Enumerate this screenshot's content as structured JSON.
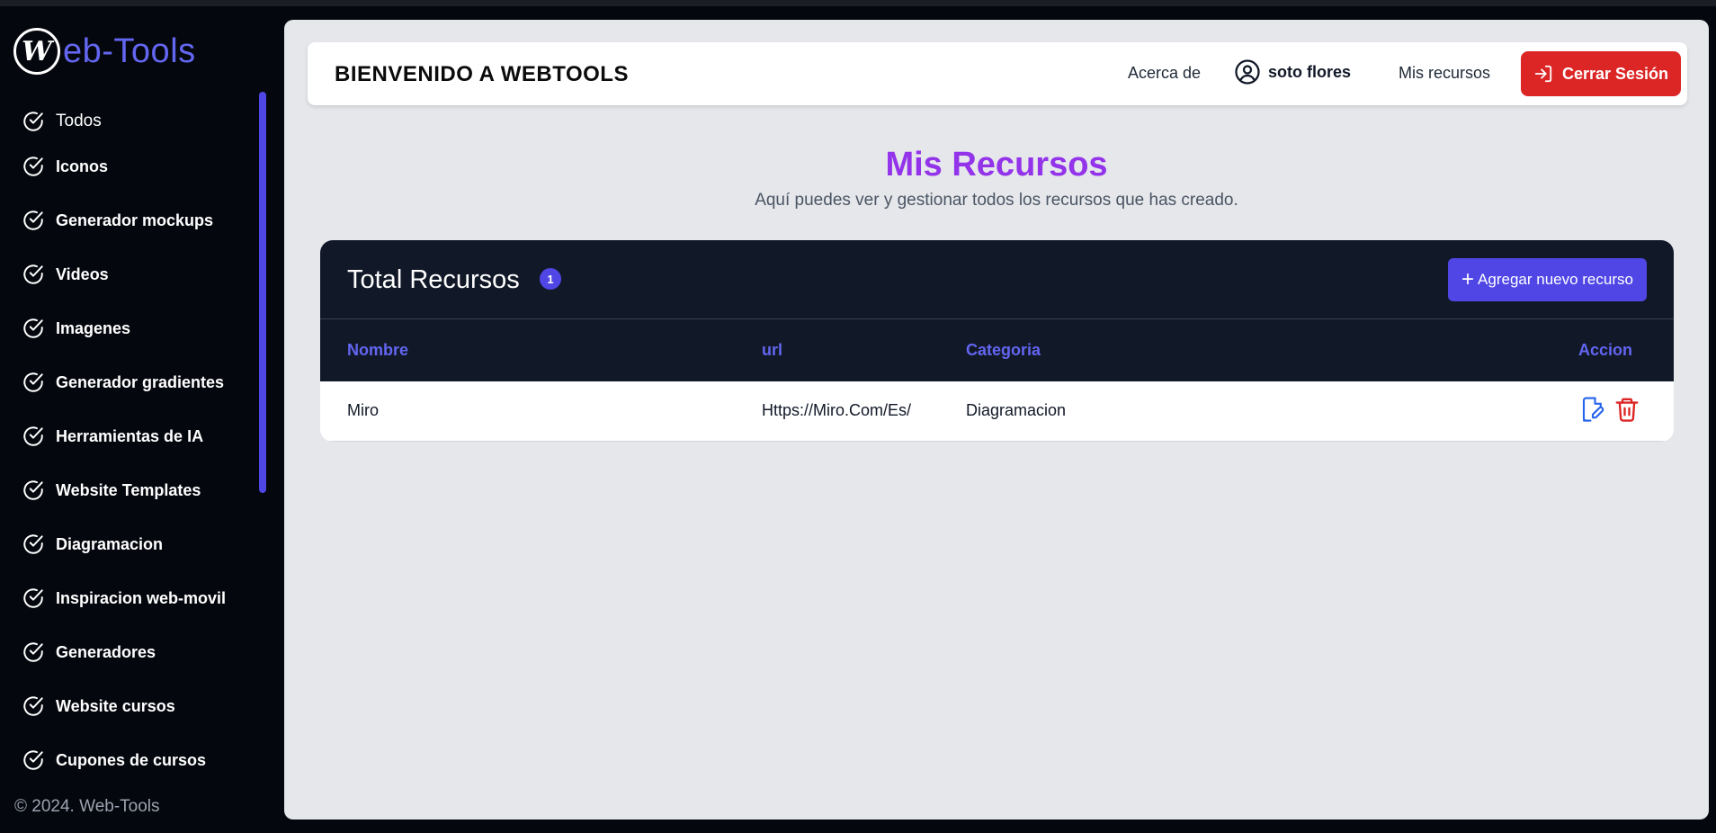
{
  "brand": {
    "logo_letter": "W",
    "name_rest": "eb-Tools",
    "accent": "#6366f1"
  },
  "sidebar": {
    "items": [
      {
        "label": "Todos",
        "icon": "check-circle-icon"
      },
      {
        "label": "Iconos",
        "icon": "check-circle-icon"
      },
      {
        "label": "Generador mockups",
        "icon": "check-circle-icon"
      },
      {
        "label": "Videos",
        "icon": "check-circle-icon"
      },
      {
        "label": "Imagenes",
        "icon": "check-circle-icon"
      },
      {
        "label": "Generador gradientes",
        "icon": "check-circle-icon"
      },
      {
        "label": "Herramientas de IA",
        "icon": "check-circle-icon"
      },
      {
        "label": "Website Templates",
        "icon": "check-circle-icon"
      },
      {
        "label": "Diagramacion",
        "icon": "check-circle-icon"
      },
      {
        "label": "Inspiracion web-movil",
        "icon": "check-circle-icon"
      },
      {
        "label": "Generadores",
        "icon": "check-circle-icon"
      },
      {
        "label": "Website cursos",
        "icon": "check-circle-icon"
      },
      {
        "label": "Cupones de cursos",
        "icon": "check-circle-icon"
      }
    ],
    "footer": "© 2024. Web-Tools"
  },
  "header": {
    "title": "BIENVENIDO A WEBTOOLS",
    "about": "Acerca de",
    "username": "soto flores",
    "my_resources": "Mis recursos",
    "logout": "Cerrar Sesión",
    "logout_color": "#dc2626"
  },
  "page": {
    "title": "Mis Recursos",
    "subtitle": "Aquí puedes ver y gestionar todos los recursos que has creado.",
    "title_color": "#9333ea"
  },
  "resources": {
    "heading": "Total Recursos",
    "count": "1",
    "add_button": "Agregar nuevo recurso",
    "columns": [
      "Nombre",
      "url",
      "Categoria",
      "Accion"
    ],
    "rows": [
      {
        "name": "Miro",
        "url": "Https://Miro.Com/Es/",
        "category": "Diagramacion"
      }
    ]
  }
}
